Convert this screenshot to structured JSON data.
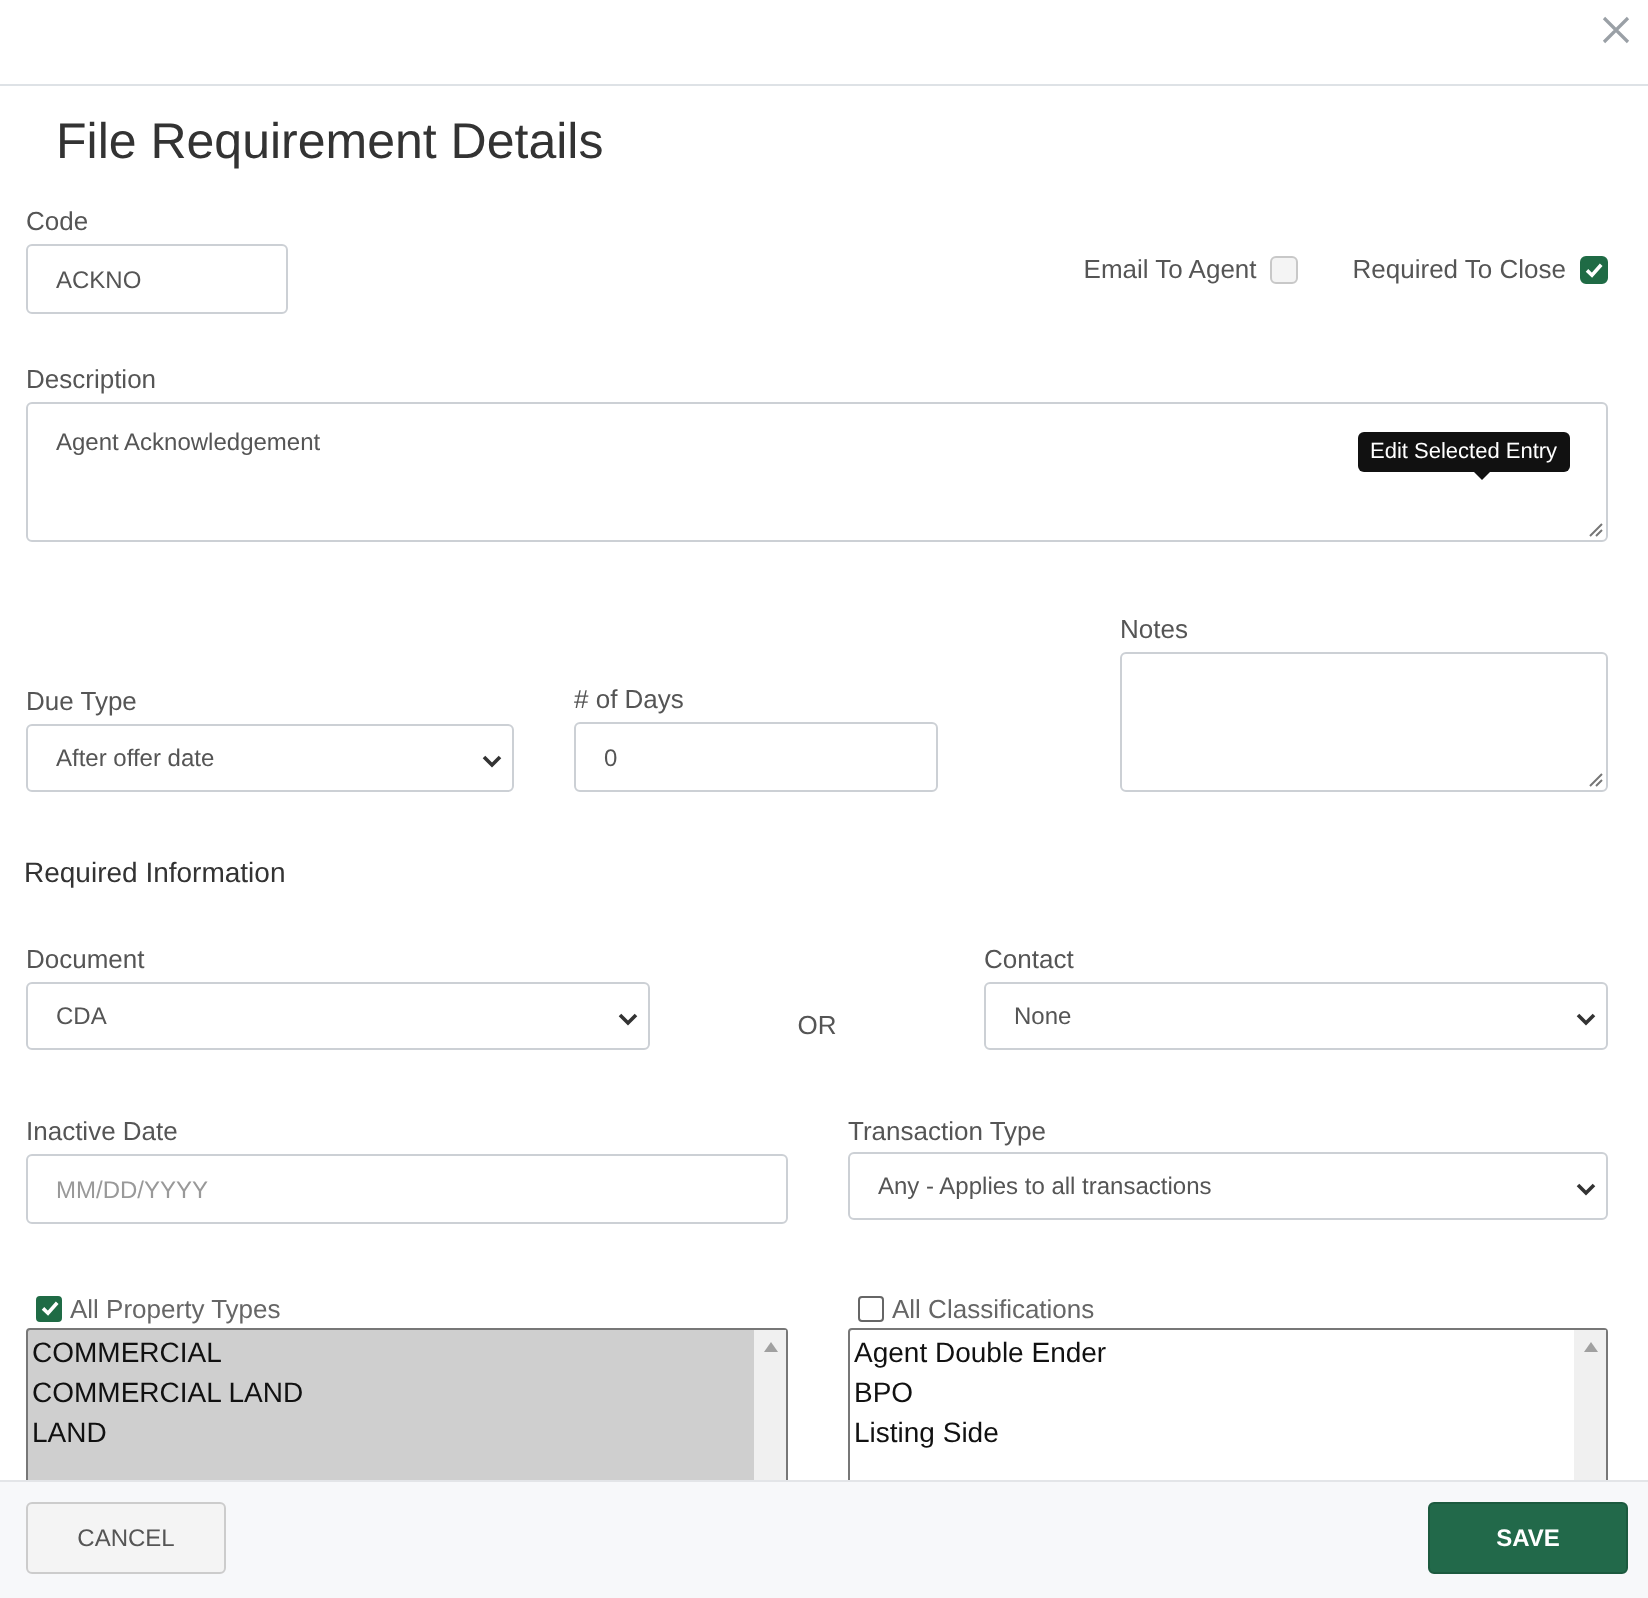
{
  "dialog": {
    "title": "File Requirement Details"
  },
  "code": {
    "label": "Code",
    "value": "ACKNO"
  },
  "flags": [
    {
      "label": "Email To Agent",
      "checked": false
    },
    {
      "label": "Required To Close",
      "checked": true
    }
  ],
  "description": {
    "label": "Description",
    "value": "Agent Acknowledgement",
    "tooltip": "Edit Selected Entry"
  },
  "due_type": {
    "label": "Due Type",
    "value": "After offer date"
  },
  "days": {
    "label": "# of Days",
    "value": "0"
  },
  "notes": {
    "label": "Notes"
  },
  "section_title": "Required Information",
  "document": {
    "label": "Document",
    "value": "CDA"
  },
  "or_label": "OR",
  "contact": {
    "label": "Contact",
    "value": "None"
  },
  "inactive_date": {
    "label": "Inactive Date",
    "placeholder": "MM/DD/YYYY"
  },
  "transaction_type": {
    "label": "Transaction Type",
    "value": "Any - Applies to all transactions"
  },
  "lists": [
    {
      "label": "All Property Types",
      "checked": true,
      "items": [
        "COMMERCIAL",
        "COMMERCIAL LAND",
        "LAND"
      ]
    },
    {
      "label": "All Classifications",
      "checked": false,
      "items": [
        "Agent Double Ender",
        "BPO",
        "Listing Side"
      ]
    }
  ],
  "buttons": [
    {
      "label": "CANCEL",
      "kind": "secondary"
    },
    {
      "label": "SAVE",
      "kind": "primary"
    }
  ]
}
